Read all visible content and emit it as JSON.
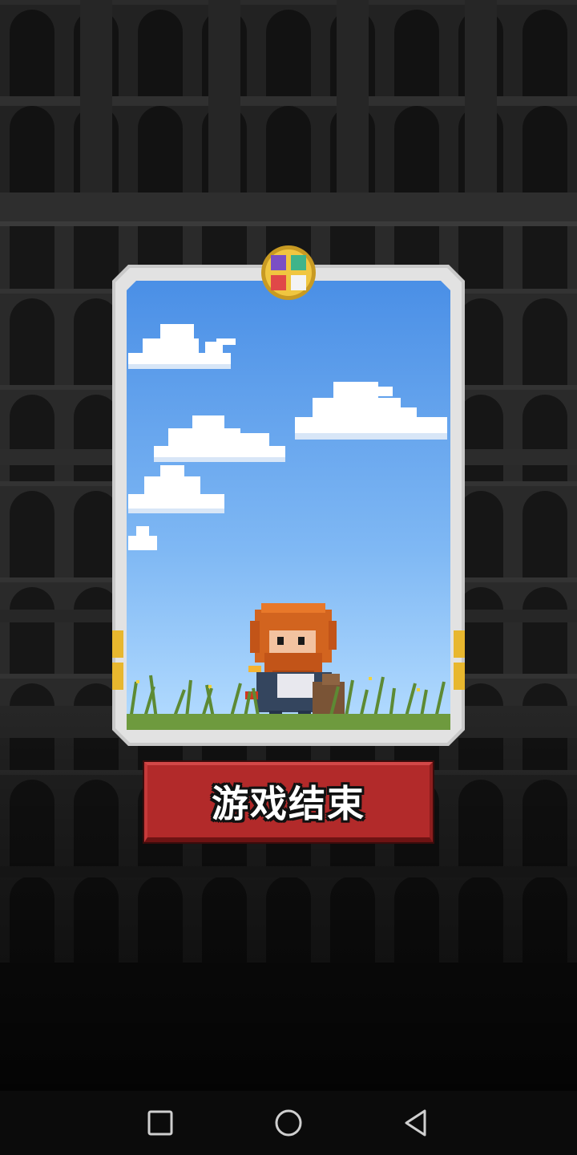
{
  "game_over": {
    "button_label": "游戏结束"
  },
  "card": {
    "scene": "pixel-hero-in-grass-under-blue-sky"
  },
  "navigation_bar": {
    "recent_icon": "square-recent-apps-icon",
    "home_icon": "circle-home-icon",
    "back_icon": "triangle-back-icon"
  },
  "colors": {
    "background": "#1c1c1c",
    "sky_top": "#4a90e8",
    "sky_bottom": "#a8d4ff",
    "button_red": "#b22a2a",
    "card_frame": "#d6d6d6",
    "emblem_gold": "#e0b030"
  }
}
